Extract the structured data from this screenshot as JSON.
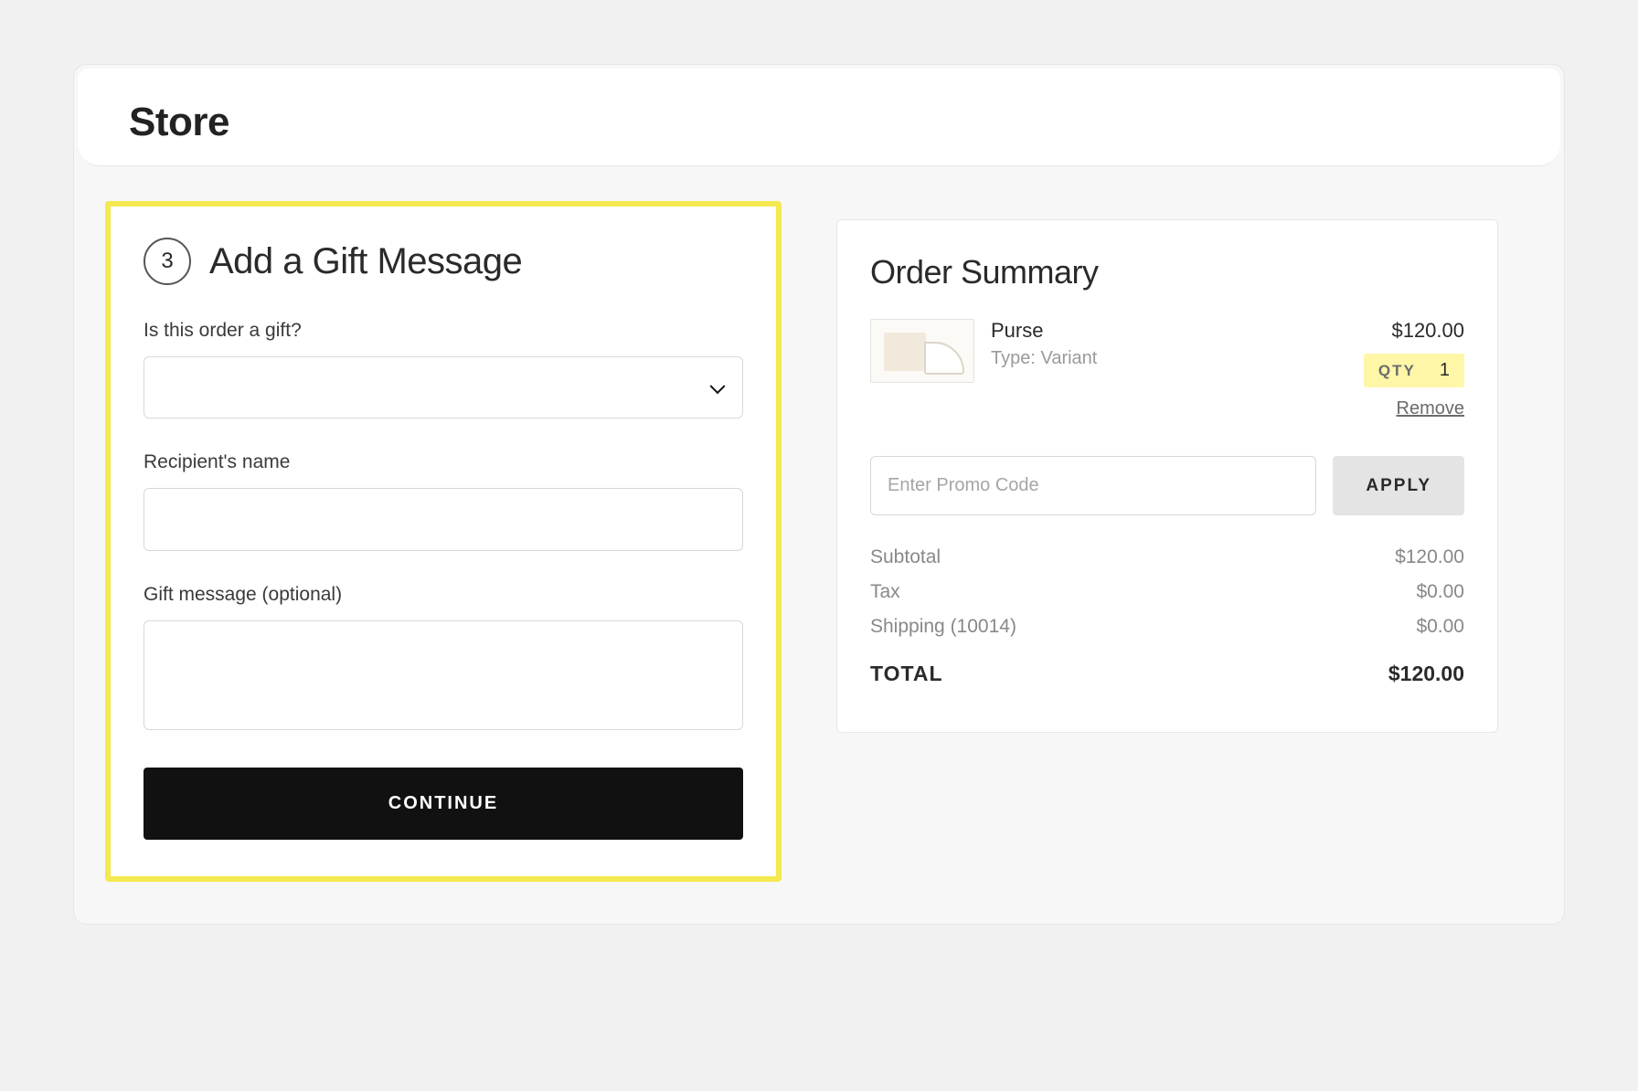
{
  "header": {
    "title": "Store"
  },
  "gift": {
    "step_number": "3",
    "title": "Add a Gift Message",
    "is_gift_label": "Is this order a gift?",
    "is_gift_value": "",
    "recipient_label": "Recipient's name",
    "recipient_value": "",
    "message_label": "Gift message (optional)",
    "message_value": "",
    "continue_label": "CONTINUE"
  },
  "summary": {
    "title": "Order Summary",
    "item": {
      "name": "Purse",
      "type": "Type: Variant",
      "price": "$120.00",
      "qty_label": "QTY",
      "qty_value": "1",
      "remove_label": "Remove"
    },
    "promo": {
      "placeholder": "Enter Promo Code",
      "apply_label": "APPLY"
    },
    "totals": {
      "subtotal_label": "Subtotal",
      "subtotal_value": "$120.00",
      "tax_label": "Tax",
      "tax_value": "$0.00",
      "shipping_label": "Shipping (10014)",
      "shipping_value": "$0.00",
      "total_label": "TOTAL",
      "total_value": "$120.00"
    }
  }
}
